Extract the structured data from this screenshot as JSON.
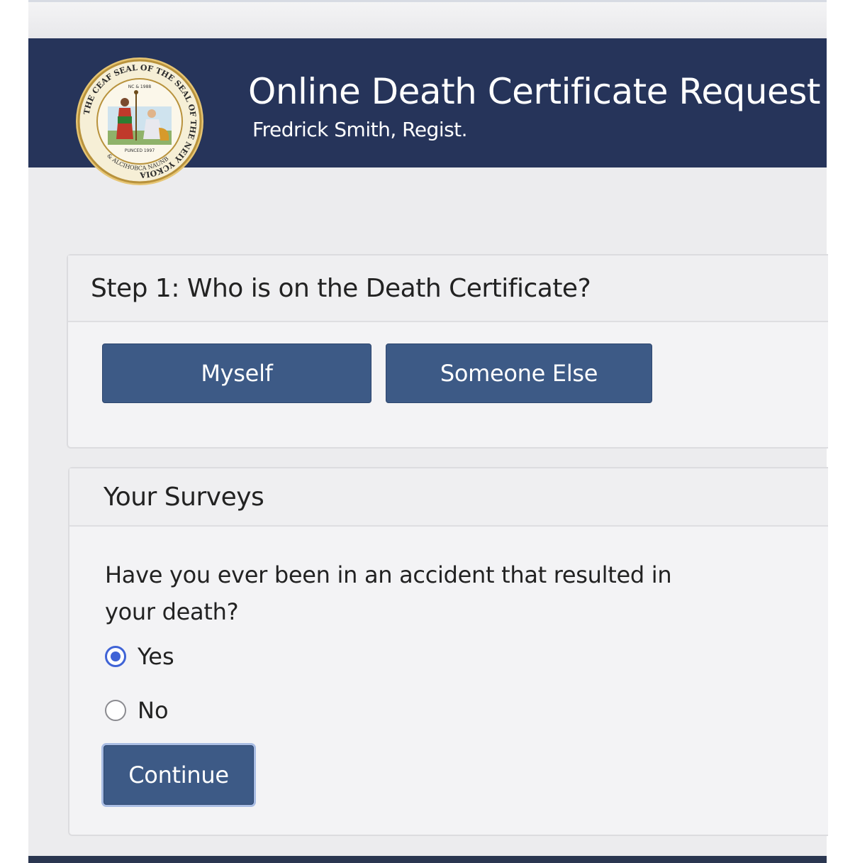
{
  "header": {
    "title": "Online Death Certificate Request",
    "subtitle": "Fredrick Smith, Regist.",
    "seal": {
      "ring_text": "THE CEAF SEAL OF THE SEAL OF THE NEIY YCKOIA",
      "inner_top": "NC & 1988",
      "inner_bottom": "PUNCED 1997",
      "lower_text": "& ALCIHOBCA NAUNB"
    }
  },
  "step1": {
    "title": "Step 1: Who is on the Death Certificate?",
    "buttons": {
      "myself": "Myself",
      "someone_else": "Someone Else"
    }
  },
  "surveys": {
    "title": "Your Surveys",
    "question": "Have you ever been in an accident that resulted in your death?",
    "options": [
      {
        "label": "Yes",
        "selected": true
      },
      {
        "label": "No",
        "selected": false
      }
    ],
    "continue_label": "Continue"
  },
  "colors": {
    "banner": "#26345a",
    "button": "#3d5a86",
    "radio_selected": "#3f63d6",
    "seal_gold": "#c9a24a"
  }
}
